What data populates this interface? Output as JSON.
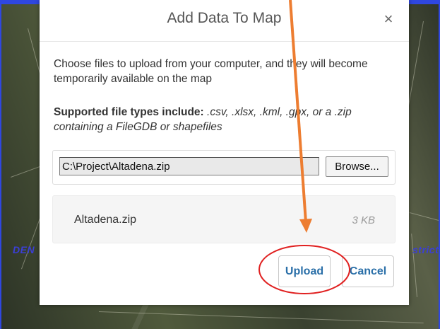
{
  "dialog": {
    "title": "Add Data To Map",
    "close_glyph": "×",
    "intro": "Choose files to upload from your computer, and they will become temporarily available on the map",
    "supported_label": "Supported file types include:",
    "supported_types": " .csv, .xlsx, .kml, .gpx, or a .zip containing a FileGDB or shapefiles",
    "file_path_value": "C:\\Project\\Altadena.zip",
    "browse_label": "Browse...",
    "files": [
      {
        "name": "Altadena.zip",
        "size": "3 KB"
      }
    ],
    "upload_label": "Upload",
    "cancel_label": "Cancel"
  },
  "map": {
    "label_left": "DEN",
    "label_right": "strict"
  },
  "colors": {
    "accent_blue": "#2a6fa8",
    "frame_blue": "#2f47e0",
    "annotation_arrow": "#ed7d31",
    "annotation_circle": "#e02020"
  },
  "icons": {
    "close": "close-icon",
    "arrow": "arrow-annotation",
    "circle": "circle-annotation"
  }
}
